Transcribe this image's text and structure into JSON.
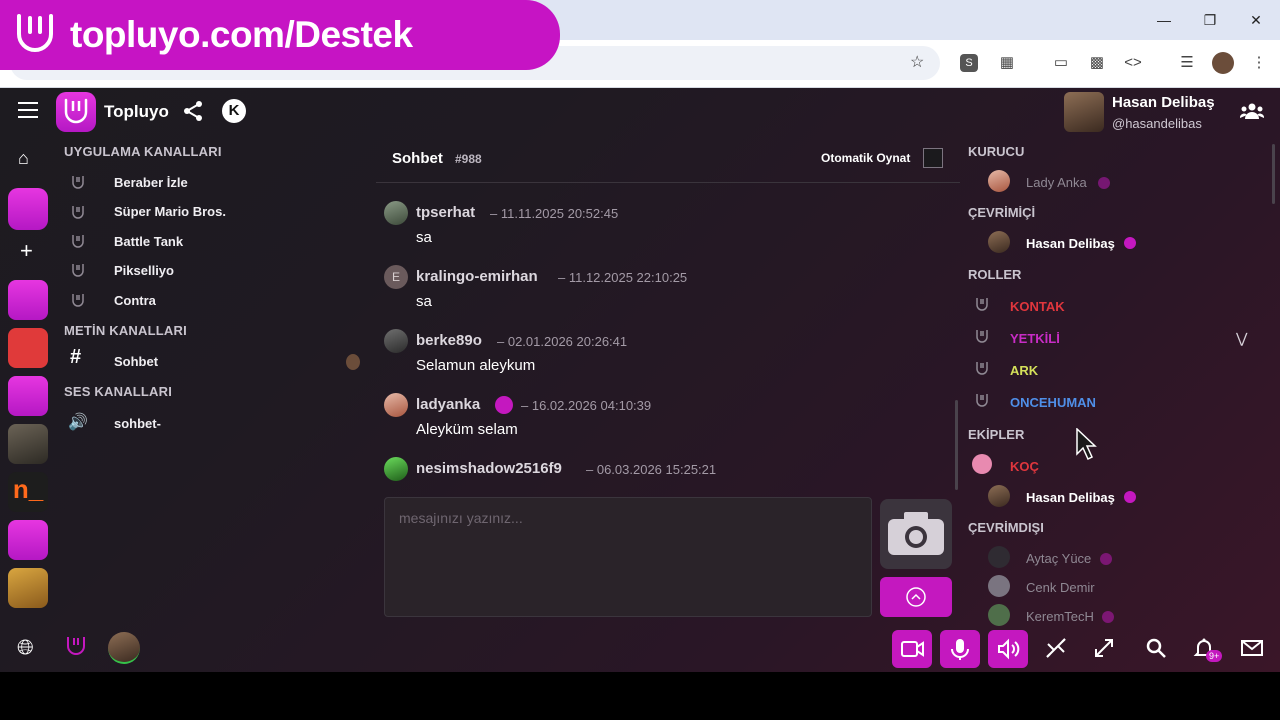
{
  "promo": {
    "text": "topluyo.com/Destek"
  },
  "app": {
    "name": "Topluyo"
  },
  "channels": {
    "app_section": "UYGULAMA KANALLARI",
    "app_channels": [
      "Beraber İzle",
      "Süper Mario Bros.",
      "Battle Tank",
      "Pikselliyo",
      "Contra"
    ],
    "text_section": "METİN KANALLARI",
    "text_channels": [
      "Sohbet"
    ],
    "voice_section": "SES KANALLARI",
    "voice_channels": [
      "sohbet-"
    ]
  },
  "chat": {
    "title": "Sohbet",
    "number": "#988",
    "autoplay_label": "Otomatik Oynat",
    "input_placeholder": "mesajınızı yazınız...",
    "messages": [
      {
        "user": "tpserhat",
        "time": "– 11.11.2025 20:52:45",
        "text": "sa"
      },
      {
        "user": "kralingo-emirhan",
        "time": "– 11.12.2025 22:10:25",
        "text": "sa",
        "avatar_letter": "E"
      },
      {
        "user": "berke89o",
        "time": "– 02.01.2026 20:26:41",
        "text": "Selamun aleykum"
      },
      {
        "user": "ladyanka",
        "time": "– 16.02.2026 04:10:39",
        "text": "Aleyküm selam"
      },
      {
        "user": "nesimshadow2516f9",
        "time": "– 06.03.2026 15:25:21",
        "text": ""
      }
    ]
  },
  "me": {
    "name": "Hasan Delibaş",
    "handle": "@hasandelibas"
  },
  "members": {
    "founder_section": "KURUCU",
    "founder": "Lady Anka",
    "online_section": "ÇEVRİMİÇİ",
    "online": [
      "Hasan Delibaş"
    ],
    "roles_section": "ROLLER",
    "roles": [
      {
        "name": "KONTAK",
        "color": "#e0363d"
      },
      {
        "name": "YETKİLİ",
        "color": "#c92cc6"
      },
      {
        "name": "ARK",
        "color": "#d4e05a"
      },
      {
        "name": "ONCEHUMAN",
        "color": "#4f8fe8"
      }
    ],
    "teams_section": "EKİPLER",
    "team_name": "KOÇ",
    "team_color": "#e0363d",
    "team_member": "Hasan Delibaş",
    "offline_section": "ÇEVRİMDIŞI",
    "offline": [
      "Aytaç Yüce",
      "Cenk Demir",
      "KeremTecH"
    ]
  },
  "bottom": {
    "notification_count": "9+"
  },
  "colors": {
    "accent": "#c418bf",
    "background": "#1f1a22"
  }
}
